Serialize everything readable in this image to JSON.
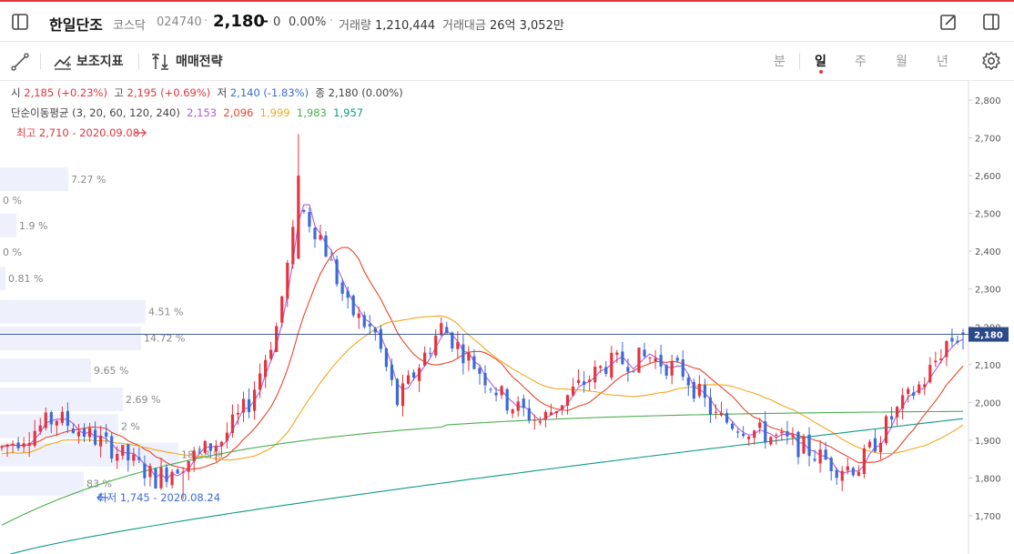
{
  "header": {
    "stock_name": "한일단조",
    "market": "코스닥",
    "code": "024740",
    "price": "2,180",
    "change_sign": "–",
    "change": "0",
    "change_pct": "0.00%",
    "volume_label": "거래량",
    "volume": "1,210,444",
    "amount_label": "거래대금",
    "amount": "26억 3,052만"
  },
  "toolbar": {
    "indicator_label": "보조지표",
    "strategy_label": "매매전략",
    "periods": [
      "분",
      "일",
      "주",
      "월",
      "년"
    ],
    "active_period": "일"
  },
  "legend": {
    "open_label": "시",
    "open": "2,185 (+0.23%)",
    "high_label": "고",
    "high": "2,195 (+0.69%)",
    "low_label": "저",
    "low": "2,140 (-1.83%)",
    "close_label": "종",
    "close": "2,180 (0.00%)",
    "ma_label": "단순이동평균 (3, 20, 60, 120, 240)",
    "ma_values": [
      {
        "value": "2,153",
        "color": "#b05ae0"
      },
      {
        "value": "2,096",
        "color": "#e8452c"
      },
      {
        "value": "1,999",
        "color": "#f0a81c"
      },
      {
        "value": "1,983",
        "color": "#4caf50"
      },
      {
        "value": "1,957",
        "color": "#0e9a8a"
      }
    ]
  },
  "chart_data": {
    "type": "candlestick",
    "y_axis": {
      "ylim": [
        1595,
        2835
      ],
      "ticks": [
        "2,800",
        "2,700",
        "2,600",
        "2,500",
        "2,400",
        "2,300",
        "2,200",
        "2,100",
        "2,000",
        "1,900",
        "1,800",
        "1,700"
      ]
    },
    "current_price": 2180,
    "current_price_label": "2,180",
    "annotations": {
      "max_label": "최고 2,710 - 2020.09.08",
      "min_label": "최저 1,745 - 2020.08.24"
    },
    "volume_profile": [
      {
        "label": "7.27 %",
        "price": 2590
      },
      {
        "label": "0 %",
        "price": 2535
      },
      {
        "label": "1.9 %",
        "price": 2468
      },
      {
        "label": "0 %",
        "price": 2398
      },
      {
        "label": "0.81 %",
        "price": 2328
      },
      {
        "label": "4.51 %",
        "price": 2240
      },
      {
        "label": "14.72 %",
        "price": 2170
      },
      {
        "label": "9.65 %",
        "price": 2085
      },
      {
        "label": "2.69 %",
        "price": 2008
      },
      {
        "label": "2 %",
        "price": 1937
      },
      {
        "label": "18.58 %",
        "price": 1862
      },
      {
        "label": "83 %",
        "price": 1785
      }
    ],
    "ma_colors": [
      "#b05ae0",
      "#e8452c",
      "#f0a81c",
      "#4caf50",
      "#0e9a8a"
    ]
  },
  "colors": {
    "up": "#e4343e",
    "down": "#3b6bd6",
    "accent": "#e4343e"
  }
}
